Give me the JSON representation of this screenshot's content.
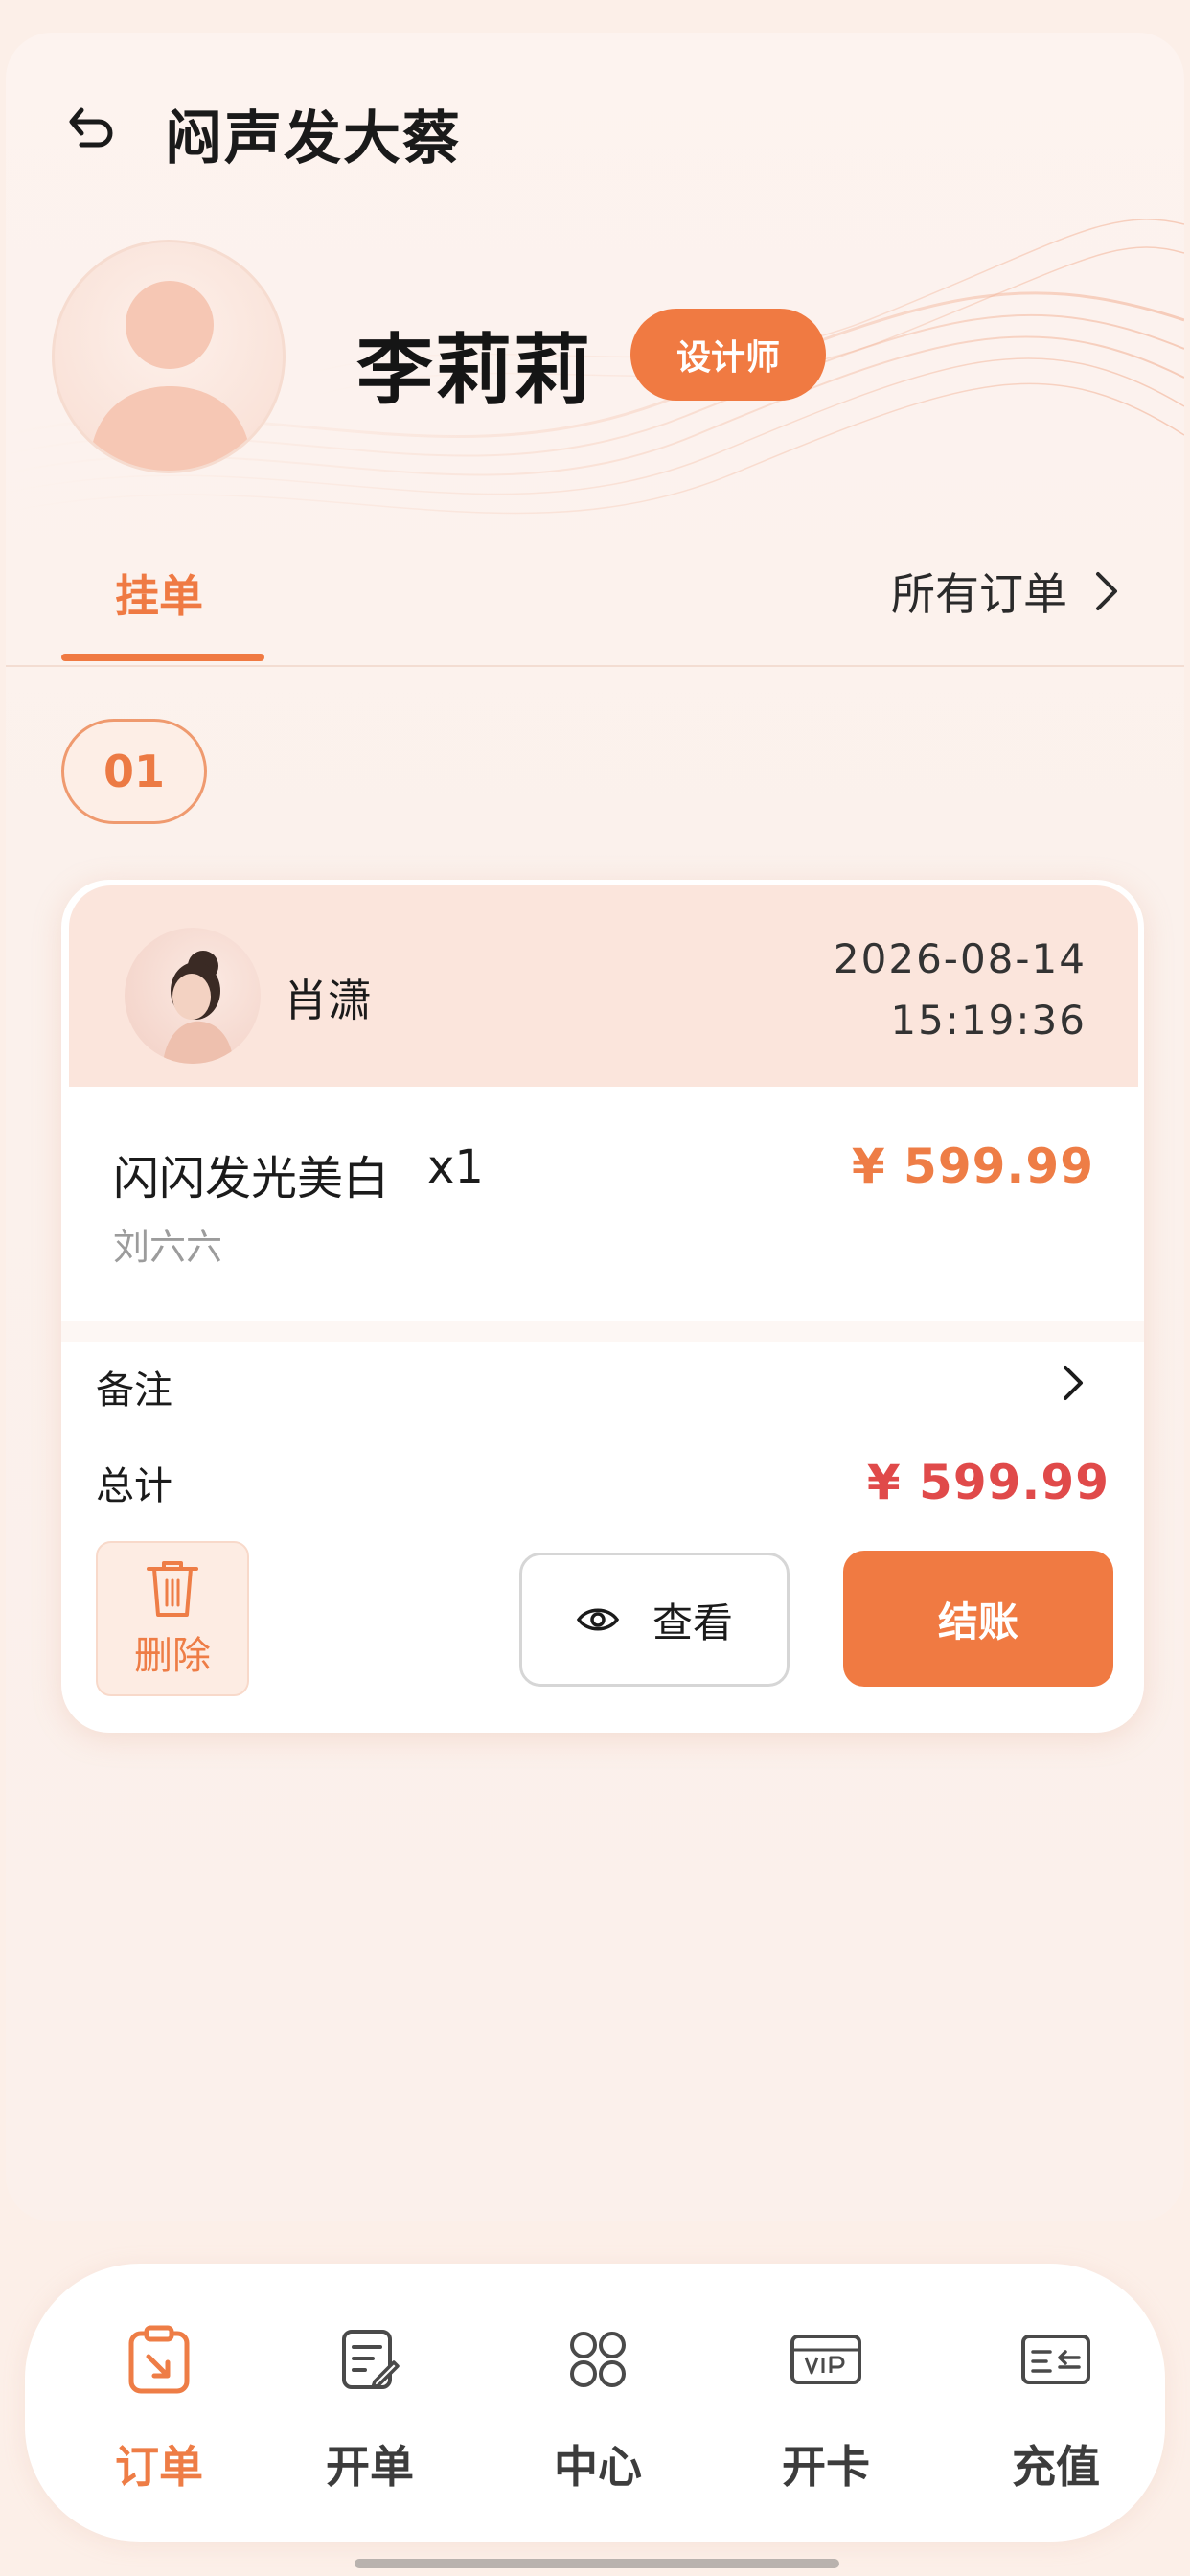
{
  "header": {
    "title": "闷声发大蔡"
  },
  "profile": {
    "name": "李莉莉",
    "role": "设计师"
  },
  "tabs": {
    "active": "挂单",
    "all_orders": "所有订单"
  },
  "order_index": "01",
  "order": {
    "customer_name": "肖潇",
    "date": "2026-08-14",
    "time": "15:19:36",
    "item_name": "闪闪发光美白",
    "item_qty": "x1",
    "item_price": "¥ 599.99",
    "item_staff": "刘六六",
    "note_label": "备注",
    "total_label": "总计",
    "total_amount": "¥ 599.99",
    "delete_label": "删除",
    "view_label": "查看",
    "checkout_label": "结账"
  },
  "nav": {
    "items": [
      {
        "label": "订单",
        "icon": "order-icon",
        "active": true
      },
      {
        "label": "开单",
        "icon": "edit-note-icon",
        "active": false
      },
      {
        "label": "中心",
        "icon": "grid-icon",
        "active": false
      },
      {
        "label": "开卡",
        "icon": "vip-card-icon",
        "active": false
      },
      {
        "label": "充值",
        "icon": "recharge-card-icon",
        "active": false
      }
    ]
  },
  "colors": {
    "accent": "#f07a42",
    "price": "#ee7d46",
    "total": "#e04a4a"
  }
}
